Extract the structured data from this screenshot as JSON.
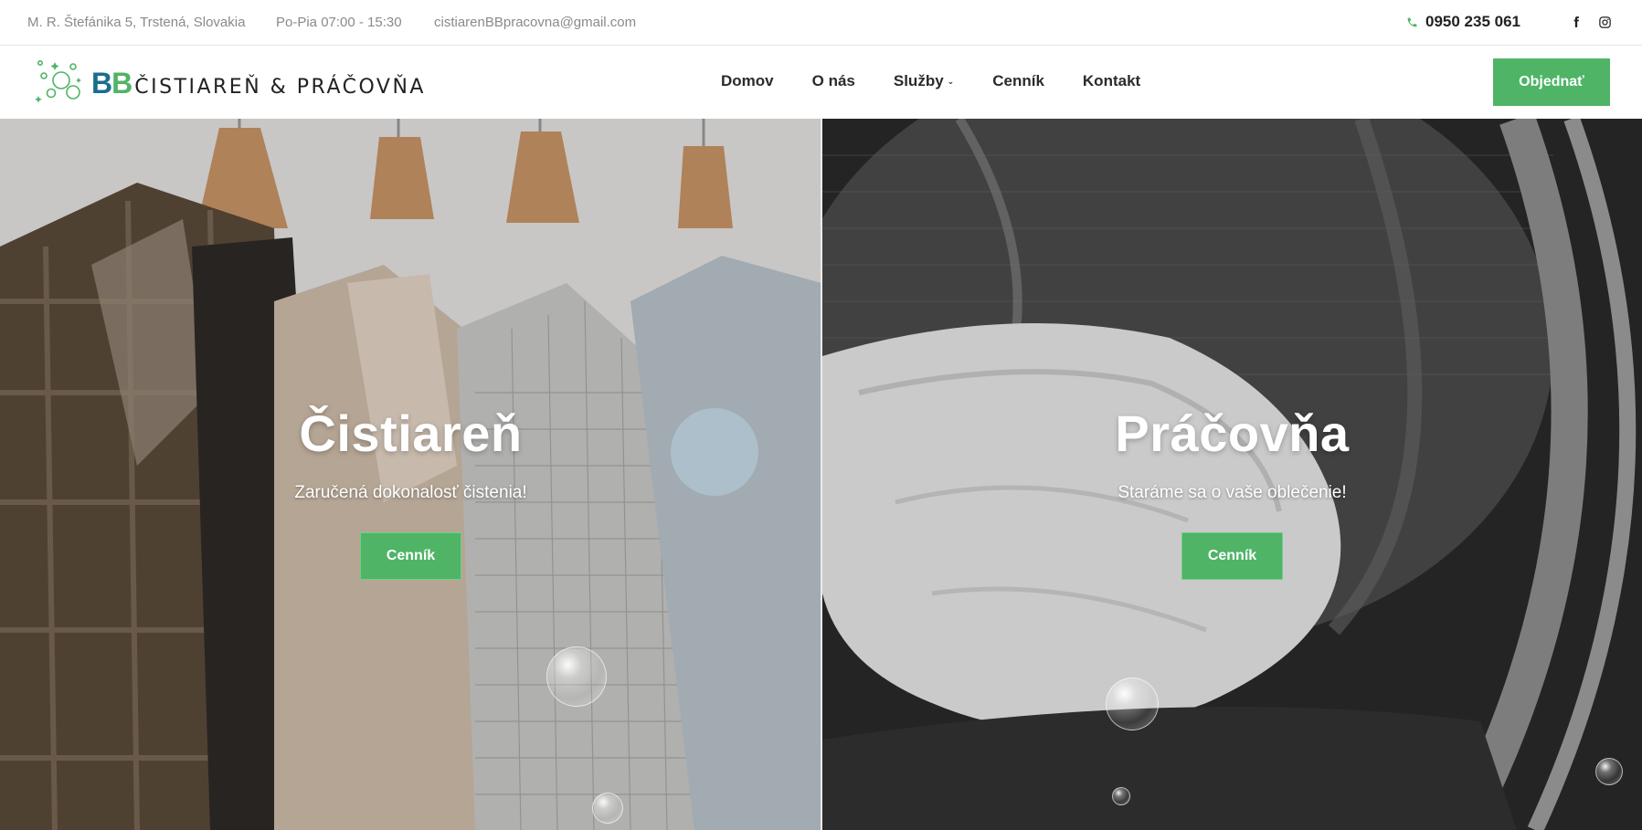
{
  "topbar": {
    "address": "M. R. Štefánika 5, Trstená, Slovakia",
    "hours": "Po-Pia 07:00 - 15:30",
    "email": "cistiarenBBpracovna@gmail.com",
    "phone": "0950 235 061",
    "phone_icon": "phone-icon",
    "social": [
      "facebook-icon",
      "instagram-icon"
    ]
  },
  "header": {
    "logo": {
      "bb_first": "B",
      "bb_second": "B",
      "name": "ČISTIAREŇ & PRÁČOVŇA"
    },
    "nav": [
      {
        "label": "Domov"
      },
      {
        "label": "O nás"
      },
      {
        "label": "Služby",
        "has_dropdown": true
      },
      {
        "label": "Cenník"
      },
      {
        "label": "Kontakt"
      }
    ],
    "order_button": "Objednať"
  },
  "hero": {
    "left": {
      "title": "Čistiareň",
      "subtitle": "Zaručená dokonalosť čistenia!",
      "button": "Cenník"
    },
    "right": {
      "title": "Práčovňa",
      "subtitle": "Staráme sa o vaše oblečenie!",
      "button": "Cenník"
    }
  },
  "colors": {
    "accent_green": "#4fb466",
    "logo_blue": "#1b6d8c",
    "text_dark": "#2b2b2b",
    "text_muted": "#8a8a8a"
  }
}
